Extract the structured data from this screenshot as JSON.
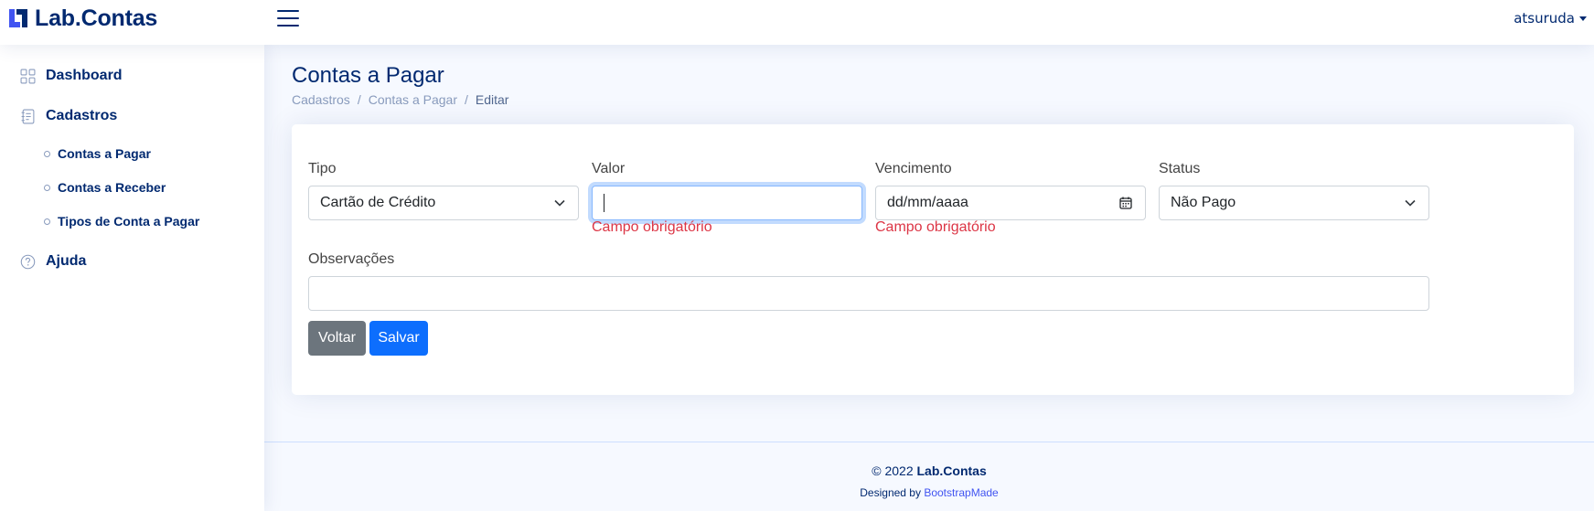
{
  "brand": {
    "name": "Lab.Contas"
  },
  "user": {
    "name": "atsuruda"
  },
  "sidebar": {
    "items": [
      {
        "label": "Dashboard",
        "icon": "grid-icon"
      },
      {
        "label": "Cadastros",
        "icon": "journal-text-icon"
      },
      {
        "label": "Ajuda",
        "icon": "question-circle-icon"
      }
    ],
    "subitems": [
      {
        "label": "Contas a Pagar"
      },
      {
        "label": "Contas a Receber"
      },
      {
        "label": "Tipos de Conta a Pagar"
      }
    ]
  },
  "page": {
    "title": "Contas a Pagar",
    "breadcrumb": [
      "Cadastros",
      "Contas a Pagar",
      "Editar"
    ],
    "breadcrumb_sep": "/"
  },
  "form": {
    "tipo": {
      "label": "Tipo",
      "value": "Cartão de Crédito"
    },
    "valor": {
      "label": "Valor",
      "value": "",
      "error": "Campo obrigatório"
    },
    "vencimento": {
      "label": "Vencimento",
      "placeholder": "dd/mm/aaaa",
      "error": "Campo obrigatório"
    },
    "status": {
      "label": "Status",
      "value": "Não Pago"
    },
    "observacoes": {
      "label": "Observações",
      "value": ""
    },
    "buttons": {
      "back": "Voltar",
      "save": "Salvar"
    }
  },
  "footer": {
    "copyright_prefix": "© 2022",
    "copyright_brand": "Lab.Contas",
    "designed_by": "Designed by",
    "credit_link": "BootstrapMade"
  },
  "colors": {
    "primary_text": "#012970",
    "accent": "#0d6efd",
    "error": "#dc3545",
    "secondary_button": "#6c757d",
    "link": "#4154f1"
  }
}
